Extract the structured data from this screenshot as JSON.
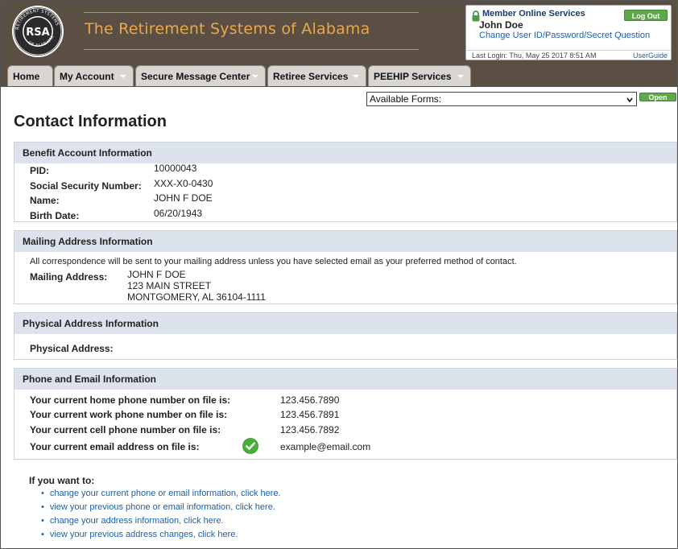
{
  "header": {
    "brand_title": "The Retirement Systems of Alabama",
    "logo_text": "RSA",
    "logo_ring_text": "THE RETIREMENT SYSTEMS OF ALABAMA"
  },
  "member_box": {
    "title": "Member Online Services",
    "name": "John Doe",
    "change_link": "Change User ID/Password/Secret Question",
    "logout_label": "Log Out",
    "last_login": "Last Login: Thu, May 25 2017 8:51 AM",
    "userguide_label": "UserGuide"
  },
  "nav": {
    "tabs": [
      {
        "label": "Home"
      },
      {
        "label": "My Account"
      },
      {
        "label": "Secure Message Center"
      },
      {
        "label": "Retiree Services"
      },
      {
        "label": "PEEHIP Services"
      }
    ]
  },
  "forms": {
    "select_value": "Available Forms:",
    "open_label": "Open"
  },
  "page_title": "Contact Information",
  "benefit": {
    "heading": "Benefit Account Information",
    "rows": [
      {
        "label": "PID:",
        "value": "10000043"
      },
      {
        "label": "Social Security Number:",
        "value": "XXX-X0-0430"
      },
      {
        "label": "Name:",
        "value": "JOHN F DOE"
      },
      {
        "label": "Birth Date:",
        "value": "06/20/1943"
      }
    ]
  },
  "mailing": {
    "heading": "Mailing Address Information",
    "note": "All correspondence will be sent to your mailing address unless you have selected email as your preferred method of contact.",
    "label": "Mailing Address:",
    "lines": [
      "JOHN F DOE",
      "123 MAIN STREET",
      "MONTGOMERY, AL 36104-1111"
    ]
  },
  "physical": {
    "heading": "Physical Address Information",
    "label": "Physical Address:"
  },
  "phone_email": {
    "heading": "Phone and Email Information",
    "rows": [
      {
        "label": "Your current home phone number on file is:",
        "value": "123.456.7890"
      },
      {
        "label": "Your current work phone number on file is:",
        "value": "123.456.7891"
      },
      {
        "label": "Your current cell phone number on file is:",
        "value": "123.456.7892"
      },
      {
        "label": "Your current email address on file is:",
        "value": "example@email.com"
      }
    ],
    "verified_color": "#49b03a"
  },
  "actions": {
    "heading": "If you want to:",
    "links": [
      "change your current phone or email information, click here.",
      "view your previous phone or email information, click here.",
      "change your address information, click here.",
      "view your previous address changes, click here."
    ]
  },
  "colors": {
    "header_bg": "#5b4f44",
    "brand_text": "#e8a94c",
    "accent_green": "#5fa84a",
    "link_blue": "#1e5fa8",
    "section_head_bg": "#dde3ec"
  }
}
